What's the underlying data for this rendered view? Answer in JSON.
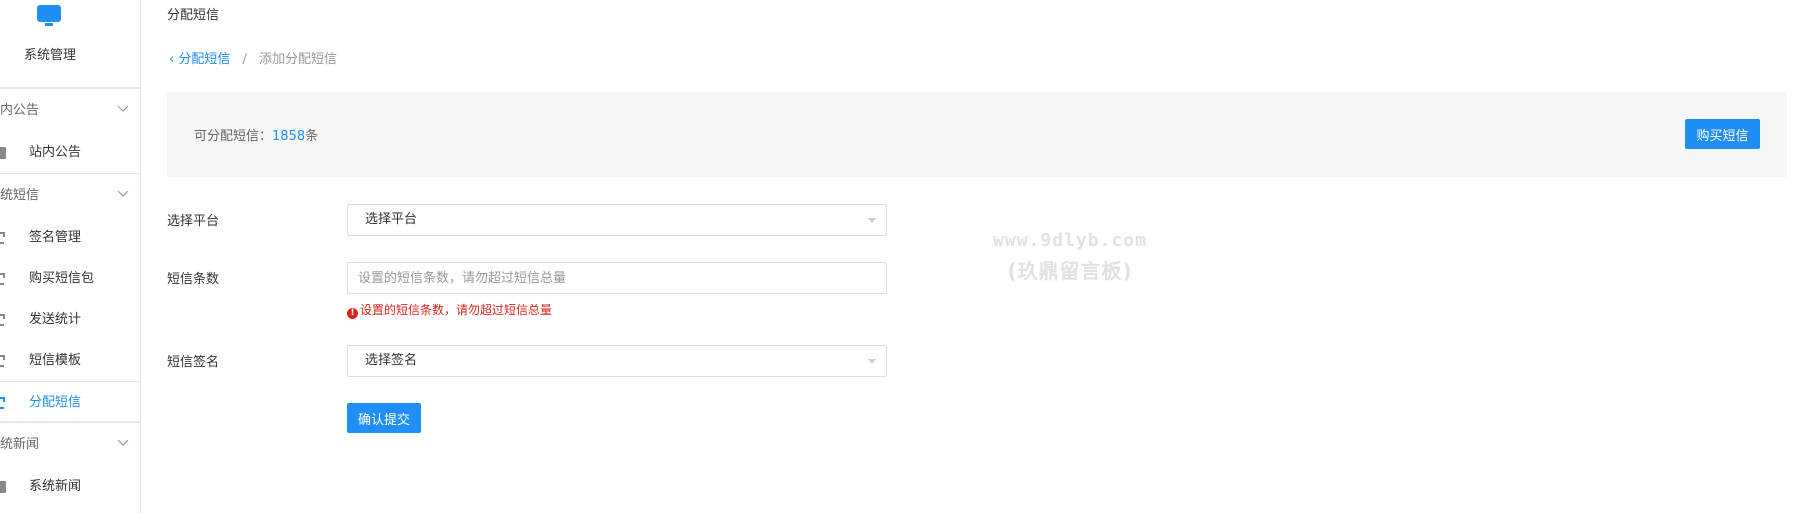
{
  "sidebar": {
    "header_title": "系统管理",
    "groups": [
      {
        "title": "内公告",
        "items": [
          {
            "label": "站内公告"
          }
        ]
      },
      {
        "title": "统短信",
        "items": [
          {
            "label": "签名管理"
          },
          {
            "label": "购买短信包"
          },
          {
            "label": "发送统计"
          },
          {
            "label": "短信模板"
          },
          {
            "label": "分配短信"
          }
        ]
      },
      {
        "title": "统新闻",
        "items": [
          {
            "label": "系统新闻"
          }
        ]
      }
    ]
  },
  "page": {
    "title": "分配短信",
    "breadcrumb": {
      "back": "分配短信",
      "current": "添加分配短信"
    }
  },
  "quota": {
    "label": "可分配短信：",
    "value": "1858",
    "unit": "条",
    "buy_button": "购买短信"
  },
  "form": {
    "platform": {
      "label": "选择平台",
      "value": "选择平台"
    },
    "count": {
      "label": "短信条数",
      "placeholder": "设置的短信条数，请勿超过短信总量",
      "error": "设置的短信条数，请勿超过短信总量"
    },
    "signature": {
      "label": "短信签名",
      "value": "选择签名"
    },
    "submit": "确认提交"
  },
  "watermark": {
    "line1": "www.9dlyb.com",
    "line2": "(玖鼎留言板)"
  },
  "colors": {
    "accent": "#1f8ff5",
    "error": "#d9251e",
    "info_bg": "#f5f6f8"
  }
}
